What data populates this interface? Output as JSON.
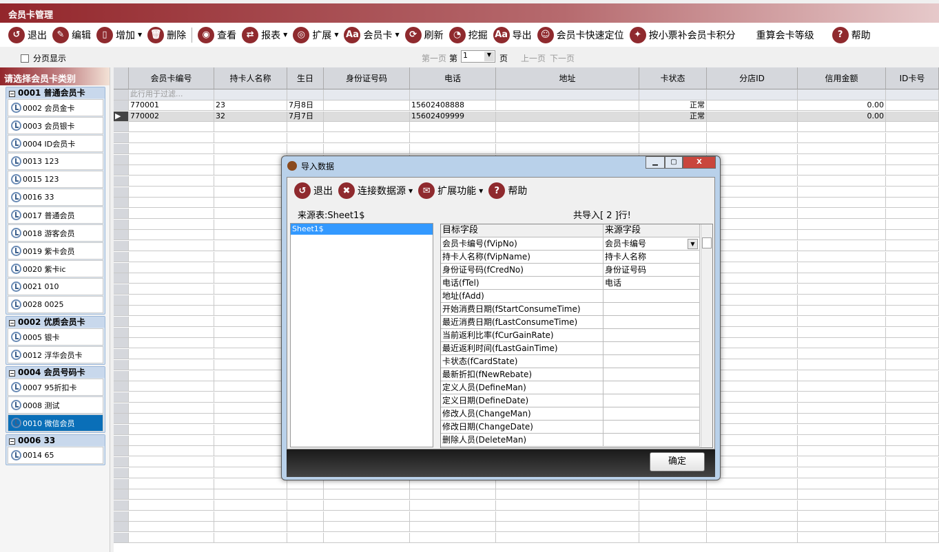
{
  "window": {
    "title": "会员卡管理"
  },
  "toolbar": [
    {
      "label": "退出",
      "icon": "undo-icon",
      "g": "↺"
    },
    {
      "label": "编辑",
      "icon": "pencil-icon",
      "g": "✎"
    },
    {
      "label": "增加",
      "icon": "document-icon",
      "g": "▯",
      "dd": true
    },
    {
      "label": "删除",
      "icon": "trash-icon",
      "g": "🗑",
      "sep": true
    },
    {
      "label": "查看",
      "icon": "eye-icon",
      "g": "◉"
    },
    {
      "label": "报表",
      "icon": "refresh-arrows-icon",
      "g": "⇄",
      "dd": true
    },
    {
      "label": "扩展",
      "icon": "lifebuoy-icon",
      "g": "◎",
      "dd": true
    },
    {
      "label": "会员卡",
      "icon": "card-icon",
      "g": "Aa",
      "dd": true
    },
    {
      "label": "刷新",
      "icon": "refresh-icon",
      "g": "⟳"
    },
    {
      "label": "挖掘",
      "icon": "pie-chart-icon",
      "g": "◔"
    },
    {
      "label": "导出",
      "icon": "export-icon",
      "g": "Aa"
    },
    {
      "label": "会员卡快速定位",
      "icon": "chat-face-icon",
      "g": "☺"
    },
    {
      "label": "按小票补会员卡积分",
      "icon": "receipt-icon",
      "g": "✦"
    },
    {
      "label": "重算会卡等级",
      "icon": "",
      "g": ""
    },
    {
      "label": "帮助",
      "icon": "help-icon",
      "g": "?"
    }
  ],
  "pager": {
    "checkbox_label": "分页显示",
    "checked": false,
    "first": "第一页",
    "page_prefix": "第",
    "page_value": "1",
    "page_suffix": "页",
    "prev": "上一页",
    "next": "下一页"
  },
  "sidebar": {
    "title": "请选择会员卡类别",
    "groups": [
      {
        "label": "0001  普通会员卡",
        "items": [
          "0002  会员金卡",
          "0003  会员银卡",
          "0004  ID会员卡",
          "0013  123",
          "0015  123",
          "0016  33",
          "0017  普通会员",
          "0018  游客会员",
          "0019  紫卡会员",
          "0020  紫卡ic",
          "0021  010",
          "0028  0025"
        ]
      },
      {
        "label": "0002  优质会员卡",
        "items": [
          "0005  银卡",
          "0012  浮华会员卡"
        ]
      },
      {
        "label": "0004  会员号码卡",
        "items": [
          "0007  95折扣卡",
          "0008  测试",
          "0010  微信会员"
        ]
      },
      {
        "label": "0006  33",
        "items": [
          "0014  65"
        ]
      }
    ],
    "selected": "0010  微信会员"
  },
  "grid": {
    "columns": [
      "会员卡编号",
      "持卡人名称",
      "生日",
      "身份证号码",
      "电话",
      "地址",
      "卡状态",
      "分店ID",
      "信用金额",
      "ID卡号"
    ],
    "filter_placeholder": "此行用于过滤...",
    "rows": [
      [
        "770001",
        "23",
        "7月8日",
        "",
        "15602408888",
        "",
        "正常",
        "",
        "0.00",
        ""
      ],
      [
        "770002",
        "32",
        "7月7日",
        "",
        "15602409999",
        "",
        "正常",
        "",
        "0.00",
        ""
      ]
    ],
    "current_row": 1
  },
  "dialog": {
    "title": "导入数据",
    "toolbar": [
      {
        "label": "退出",
        "icon": "undo-icon",
        "g": "↺"
      },
      {
        "label": "连接数据源",
        "icon": "tools-icon",
        "g": "✖",
        "dd": true
      },
      {
        "label": "扩展功能",
        "icon": "envelope-icon",
        "g": "✉",
        "dd": true
      },
      {
        "label": "帮助",
        "icon": "help-icon",
        "g": "?"
      }
    ],
    "source_label": "来源表:Sheet1$",
    "count_label": "共导入[ 2 ]行!",
    "sheets": [
      "Sheet1$"
    ],
    "mapping_headers": [
      "目标字段",
      "来源字段"
    ],
    "mappings": [
      [
        "会员卡编号(fVipNo)",
        "会员卡编号"
      ],
      [
        "持卡人名称(fVipName)",
        "持卡人名称"
      ],
      [
        "身份证号码(fCredNo)",
        "身份证号码"
      ],
      [
        "电话(fTel)",
        "电话"
      ],
      [
        "地址(fAdd)",
        ""
      ],
      [
        "开始消费日期(fStartConsumeTime)",
        ""
      ],
      [
        "最近消费日期(fLastConsumeTime)",
        ""
      ],
      [
        "当前返利比率(fCurGainRate)",
        ""
      ],
      [
        "最近返利时间(fLastGainTime)",
        ""
      ],
      [
        "卡状态(fCardState)",
        ""
      ],
      [
        "最新折扣(fNewRebate)",
        ""
      ],
      [
        "定义人员(DefineMan)",
        ""
      ],
      [
        "定义日期(DefineDate)",
        ""
      ],
      [
        "修改人员(ChangeMan)",
        ""
      ],
      [
        "修改日期(ChangeDate)",
        ""
      ],
      [
        "删除人员(DeleteMan)",
        ""
      ]
    ],
    "ok_label": "确定"
  }
}
